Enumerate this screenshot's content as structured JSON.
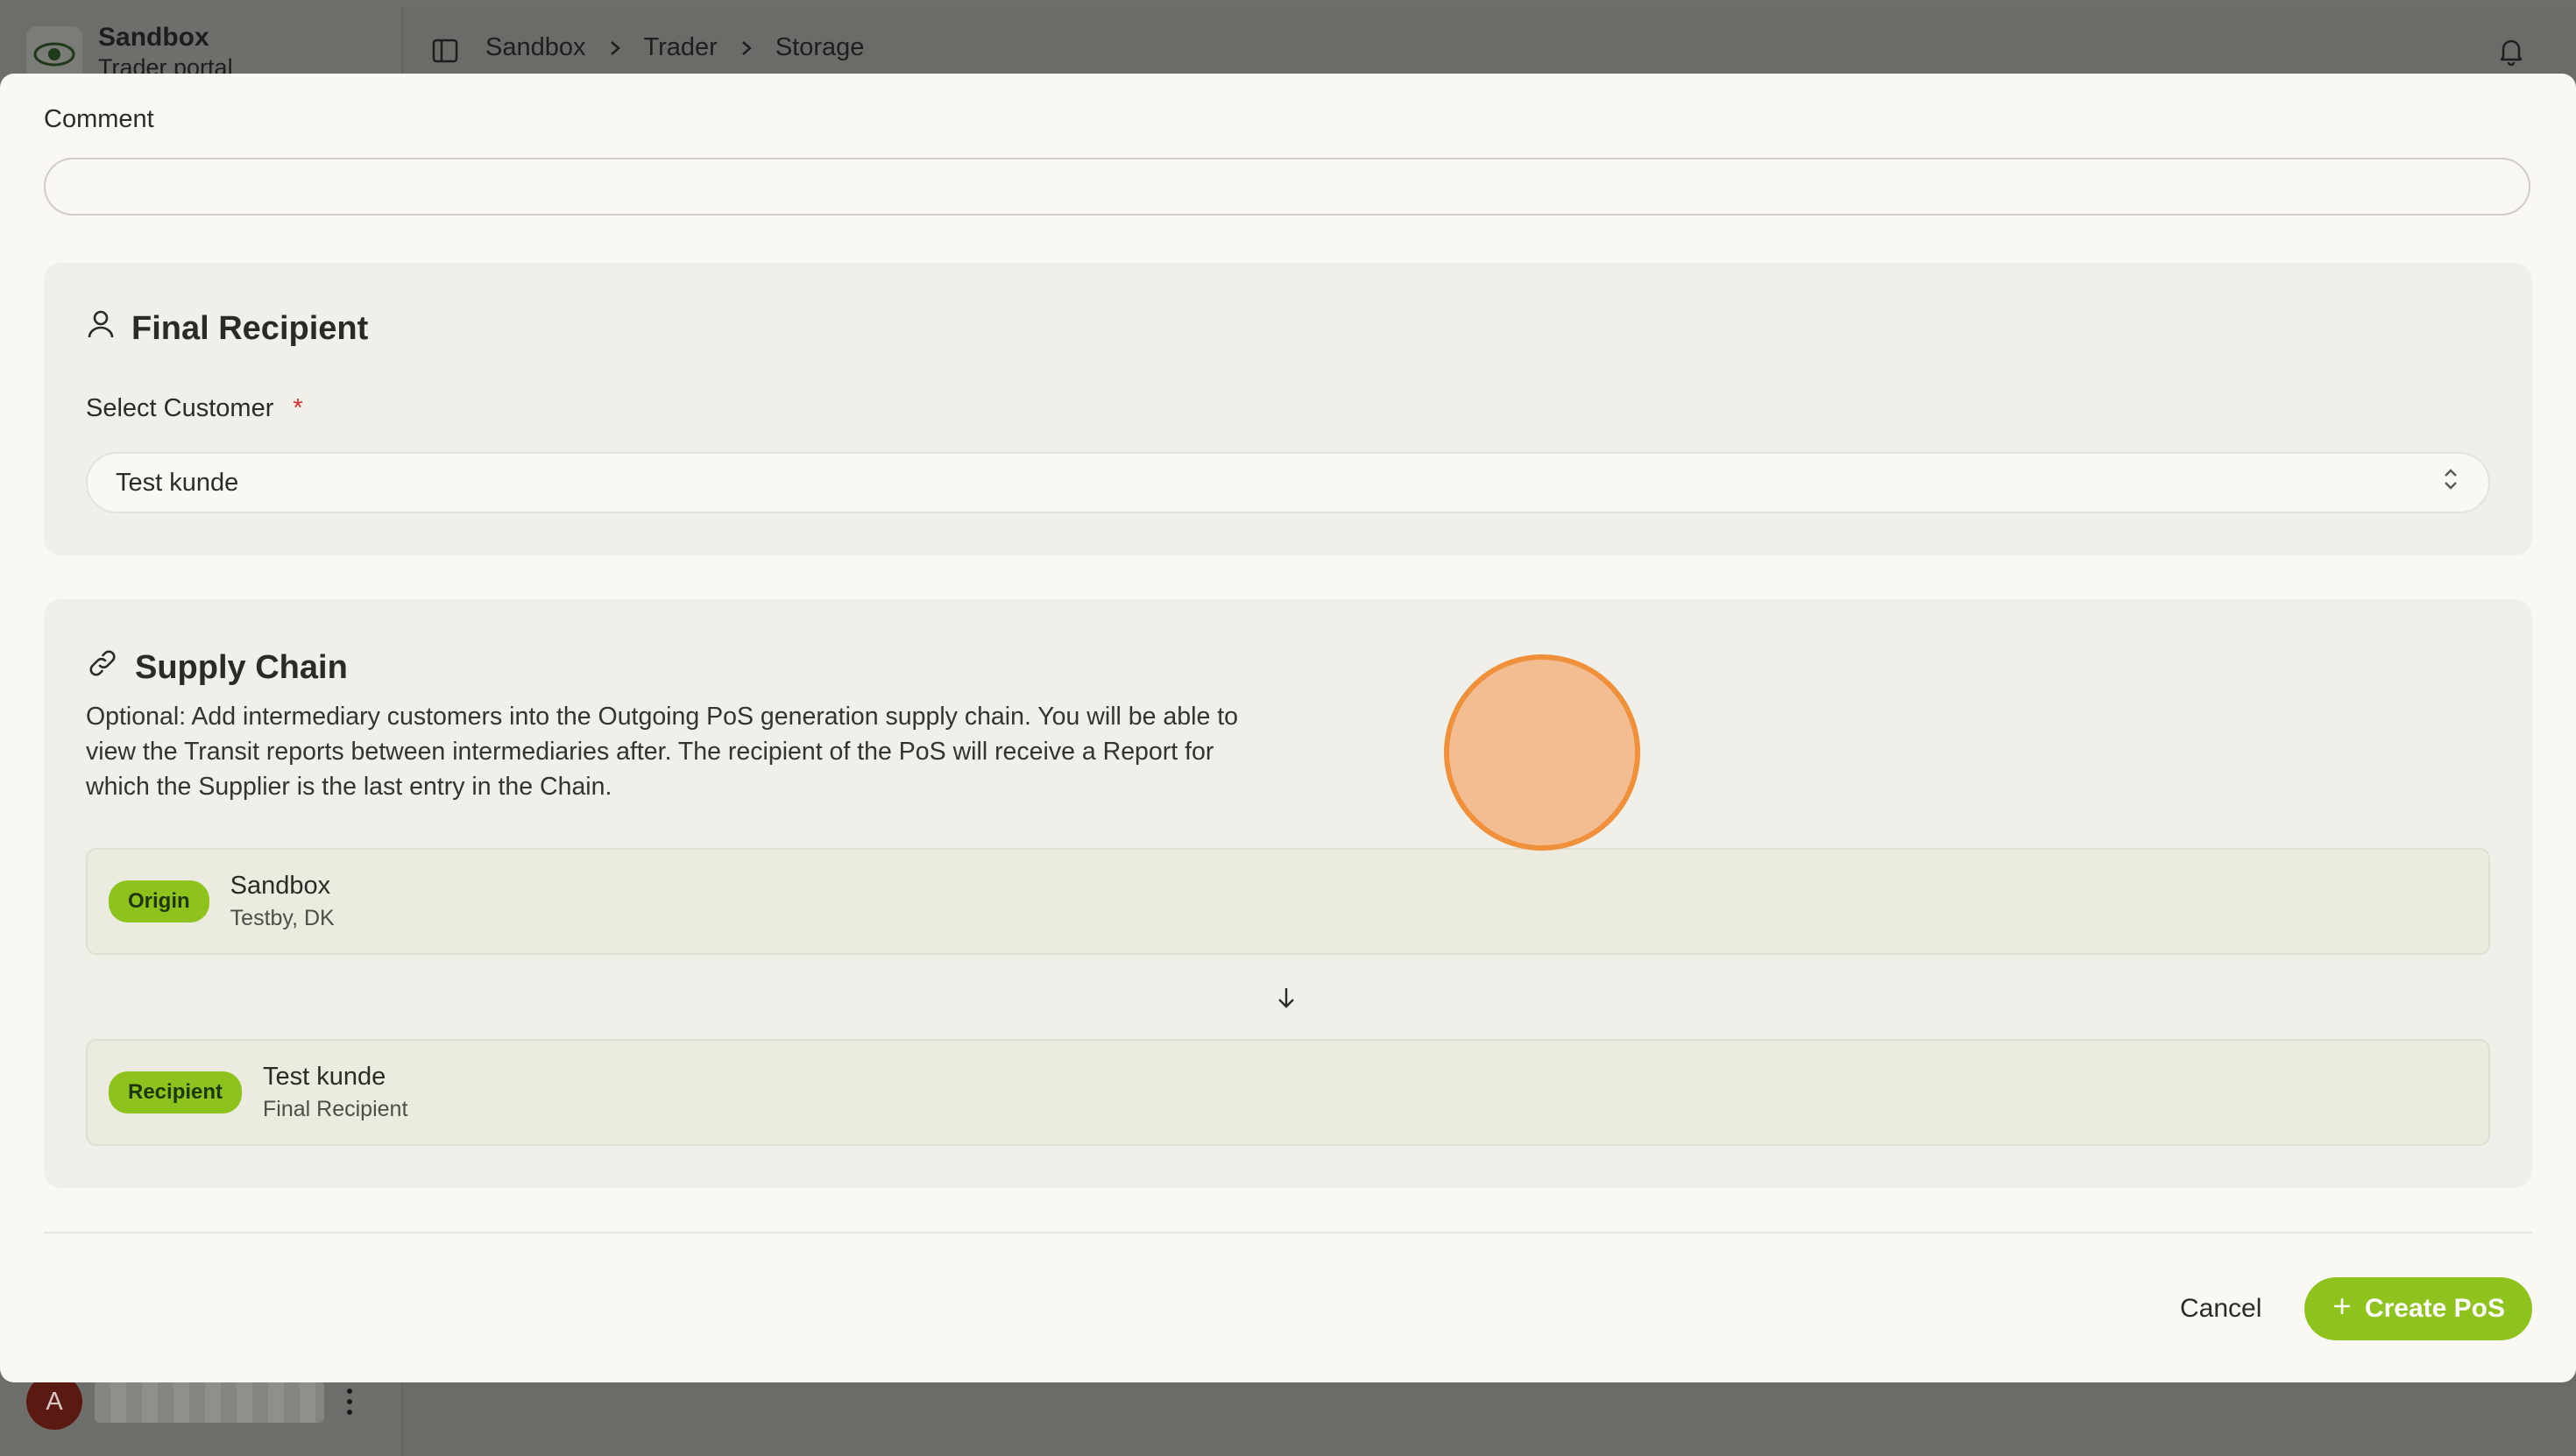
{
  "app": {
    "brand_name": "Sandbox",
    "brand_sub": "Trader portal"
  },
  "breadcrumb": [
    "Sandbox",
    "Trader",
    "Storage"
  ],
  "user": {
    "avatar_letter": "A"
  },
  "modal": {
    "comment_label": "Comment",
    "comment_value": "",
    "final_recipient": {
      "title": "Final Recipient",
      "select_label": "Select Customer",
      "required_mark": "*",
      "selected_value": "Test kunde"
    },
    "supply_chain": {
      "title": "Supply Chain",
      "description": "Optional: Add intermediary customers into the Outgoing PoS generation supply chain. You will be able to view the Transit reports between intermediaries after. The recipient of the PoS will receive a Report for which the Supplier is the last entry in the Chain.",
      "items": [
        {
          "badge": "Origin",
          "name": "Sandbox",
          "sub": "Testby, DK"
        },
        {
          "badge": "Recipient",
          "name": "Test kunde",
          "sub": "Final Recipient"
        }
      ]
    },
    "actions": {
      "cancel": "Cancel",
      "create": "Create PoS"
    }
  },
  "colors": {
    "accent": "#8ec21c",
    "required": "#d2332c",
    "click_indicator": "#f0903a"
  }
}
